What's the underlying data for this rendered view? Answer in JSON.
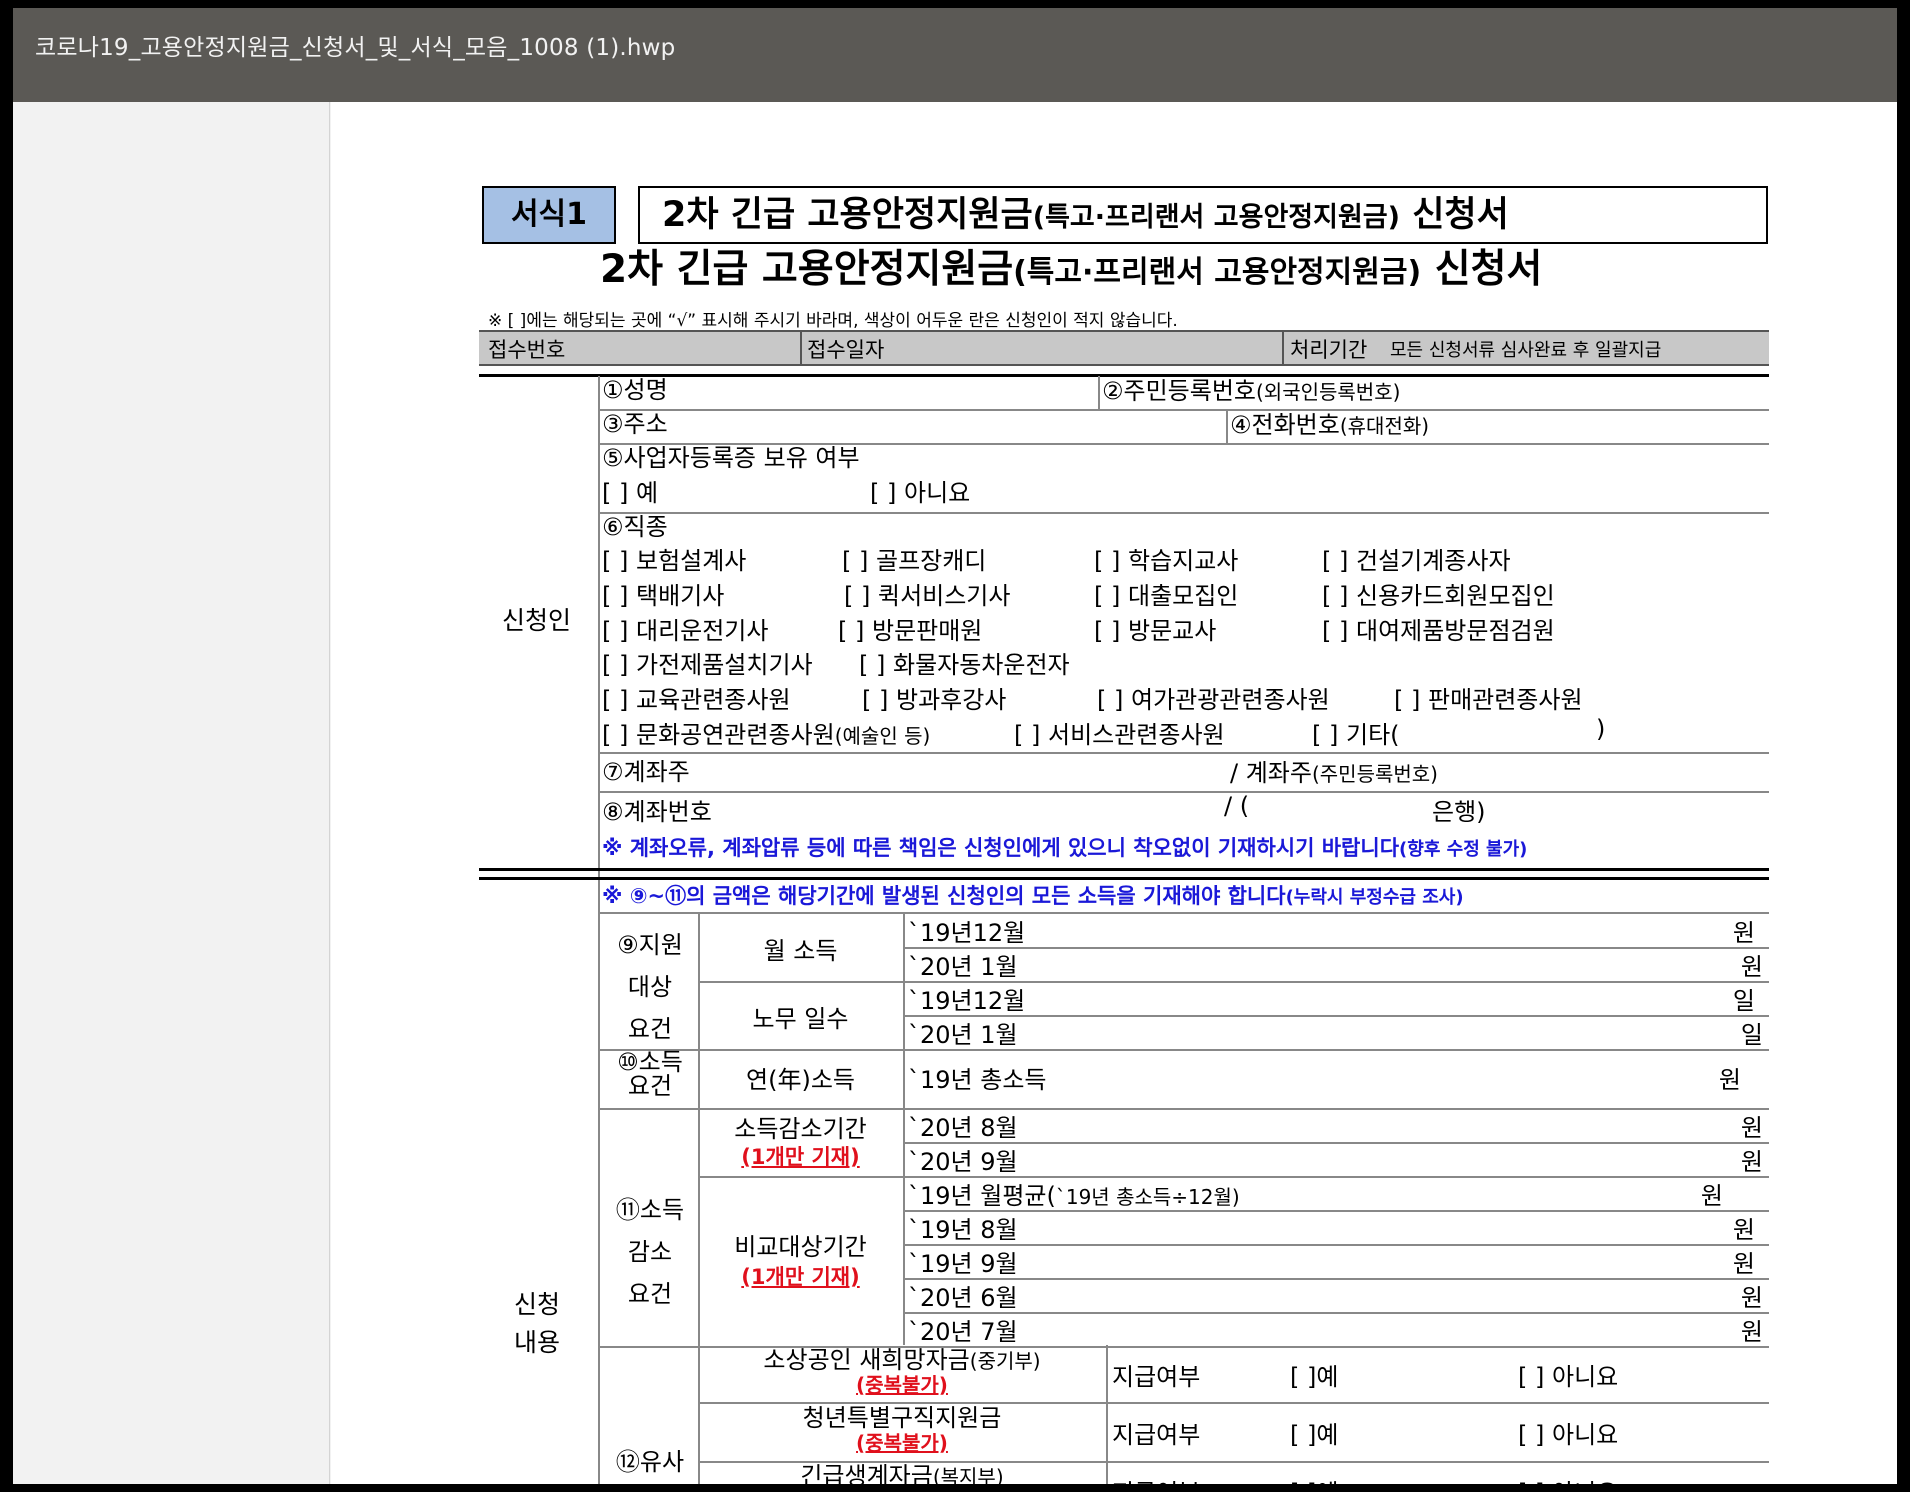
{
  "window": {
    "title": "코로나19_고용안정지원금_신청서_및_서식_모음_1008 (1).hwp"
  },
  "form": {
    "badge": "서식1",
    "boxed_title_main": "2차 긴급 고용안정지원금",
    "boxed_title_sub": "(특고·프리랜서 고용안정지원금)",
    "boxed_title_end": "신청서",
    "title_main": "2차 긴급 고용안정지원금",
    "title_sub": "(특고·프리랜서 고용안정지원금)",
    "title_end": "신청서",
    "notice": "※ [ ]에는 해당되는 곳에 “√” 표시해 주시기 바라며, 색상이 어두운 란은 신청인이 적지 않습니다."
  },
  "receipt": {
    "number_label": "접수번호",
    "date_label": "접수일자",
    "period_label": "처리기간",
    "period_value": "모든 신청서류 심사완료 후 일괄지급"
  },
  "applicant": {
    "section_label": "신청인",
    "name_label": "①성명",
    "rrn_label": "②주민등록번호",
    "rrn_note": "(외국인등록번호)",
    "address_label": "③주소",
    "phone_label": "④전화번호",
    "phone_note": "(휴대전화)",
    "biz_label": "⑤사업자등록증 보유 여부",
    "biz_yes": "[    ] 예",
    "biz_no": "[    ] 아니요",
    "job_label": "⑥직종",
    "jobs": [
      [
        "[    ] 보험설계사",
        "[    ] 골프장캐디",
        "[    ] 학습지교사",
        "[    ] 건설기계종사자"
      ],
      [
        "[    ] 택배기사",
        "[    ] 퀵서비스기사",
        "[    ] 대출모집인",
        "[    ] 신용카드회원모집인"
      ],
      [
        "[    ] 대리운전기사",
        "[    ] 방문판매원",
        "[    ] 방문교사",
        "[    ] 대여제품방문점검원"
      ],
      [
        "[    ] 가전제품설치기사",
        "[    ] 화물자동차운전자"
      ],
      [
        "[    ] 교육관련종사원",
        "[    ] 방과후강사",
        "[    ] 여가관광관련종사원",
        "[    ] 판매관련종사원"
      ]
    ],
    "job_culture": "[    ] 문화공연관련종사원",
    "job_culture_note": "(예술인 등)",
    "job_service": "[    ] 서비스관련종사원",
    "job_other": "[    ] 기타(",
    "job_other_close": ")",
    "holder_label": "⑦계좌주",
    "holder_rrn_label": "/  계좌주",
    "holder_rrn_note": "(주민등록번호)",
    "account_label": "⑧계좌번호",
    "bank_open": "/  (",
    "bank_close": "은행)",
    "account_warning": "※  계좌오류, 계좌압류 등에 따른 책임은 신청인에게 있으니 착오없이 기재하시기 바랍니다",
    "account_warning_note": "(향후 수정 불가)"
  },
  "application": {
    "section_label_1": "신청",
    "section_label_2": "내용",
    "income_warning": "※  ⑨~⑪의 금액은 해당기간에 발생된 신청인의 모든 소득을 기재해야 합니다",
    "income_warning_note": "(누락시 부정수급 조사)",
    "req9": [
      "⑨지원",
      "대상",
      "요건"
    ],
    "monthly_income": "월  소득",
    "work_days": "노무  일수",
    "months_income": [
      "`19년12월",
      "`20년  1월"
    ],
    "months_days": [
      "`19년12월",
      "`20년  1월"
    ],
    "unit_won": "원",
    "unit_day": "일",
    "req10": [
      "⑩소득",
      "요건"
    ],
    "annual_income": "연(年)소득",
    "annual_value": "`19년  총소득",
    "req11": [
      "⑪소득",
      "감소",
      "요건"
    ],
    "decrease_period": "소득감소기간",
    "one_only": "(1개만  기재)",
    "decrease_months": [
      "`20년  8월",
      "`20년  9월"
    ],
    "compare_period": "비교대상기간",
    "compare_avg": "`19년  월평균(",
    "compare_avg_note": "`19년  총소득÷12월)",
    "compare_months": [
      "`19년  8월",
      "`19년  9월",
      "`20년  6월",
      "`20년  7월"
    ],
    "req12": "⑫유사",
    "similar": [
      {
        "name": "소상공인  새희망자금",
        "note": "(중기부)",
        "dup": "(중복불가)"
      },
      {
        "name": "청년특별구직지원금",
        "note": "",
        "dup": "(중복불가)"
      },
      {
        "name": "긴급생계자금",
        "note": "(복지부)",
        "dup": ""
      }
    ],
    "paid_label": "지급여부",
    "paid_yes": "[    ]예",
    "paid_no": "[    ]  아니요"
  }
}
